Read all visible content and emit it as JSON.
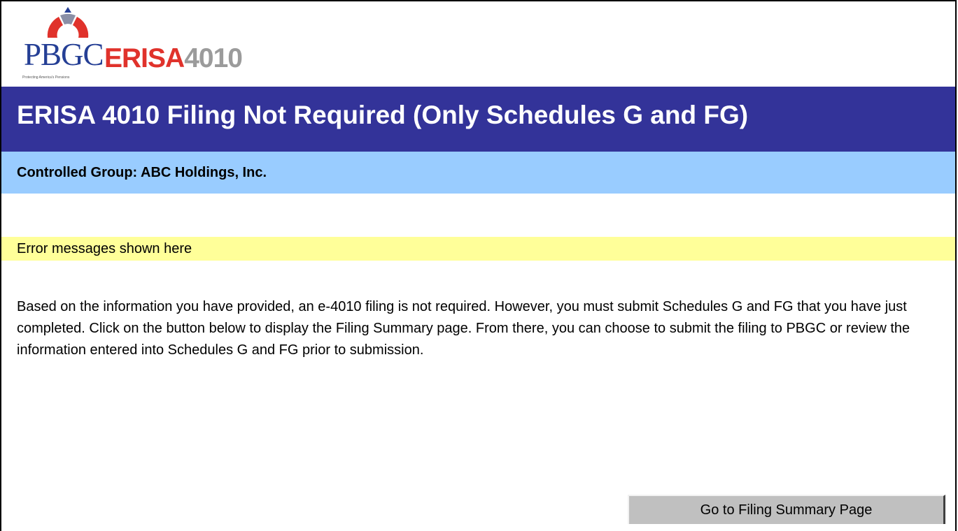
{
  "logo": {
    "brand": "PBGC",
    "product_word": "ERISA",
    "product_number": "4010",
    "tagline": "Protecting America's Pensions",
    "colors": {
      "brand_blue": "#253f95",
      "erisa_red": "#e0322b",
      "number_gray": "#9b9b9b"
    }
  },
  "header": {
    "title": "ERISA 4010 Filing Not Required (Only Schedules G and FG)",
    "background": "#333399"
  },
  "controlled_group": {
    "text": "Controlled Group: ABC Holdings, Inc.",
    "background": "#99ccff"
  },
  "error_area": {
    "text": "Error messages shown here",
    "background": "#ffff99"
  },
  "main": {
    "paragraph": "Based on the information you have provided, an e-4010 filing is not required.  However, you must submit Schedules G and FG that you have just completed.  Click on the button below to display the Filing Summary page.  From there, you can choose to submit the filing to PBGC or review the information entered into Schedules G and FG prior to submission."
  },
  "actions": {
    "go_to_summary_label": "Go to Filing Summary Page"
  }
}
